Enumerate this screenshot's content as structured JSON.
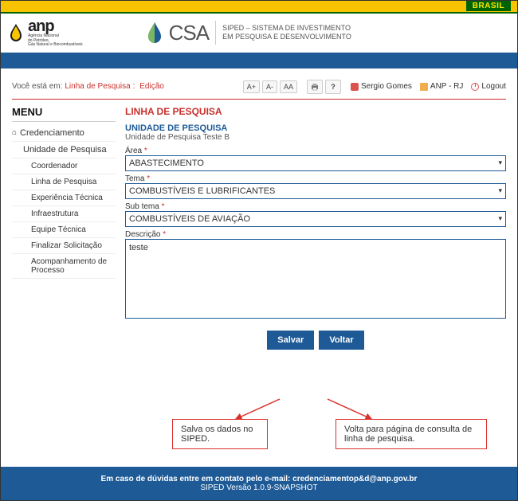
{
  "brasil_label": "BRASIL",
  "anp": {
    "name": "anp",
    "sub1": "Agência Nacional",
    "sub2": "do Petróleo,",
    "sub3": "Gás Natural e Biocombustíveis"
  },
  "csa": {
    "name": "CSA",
    "line1": "SIPED – SISTEMA DE INVESTIMENTO",
    "line2": "EM PESQUISA E DESENVOLVIMENTO"
  },
  "breadcrumb": {
    "label": "Você está em:",
    "link1": "Linha de Pesquisa",
    "link2": "Edição"
  },
  "toolbar": {
    "aplus": "A+",
    "aminus": "A-",
    "areset": "AA"
  },
  "user": {
    "name": "Sergio Gomes",
    "org": "ANP - RJ",
    "logout": "Logout"
  },
  "menu": {
    "title": "MENU",
    "cred": "Credenciamento",
    "unit": "Unidade de Pesquisa",
    "items": [
      "Coordenador",
      "Linha de Pesquisa",
      "Experiência Técnica",
      "Infraestrutura",
      "Equipe Técnica",
      "Finalizar Solicitação",
      "Acompanhamento de Processo"
    ]
  },
  "form": {
    "title": "LINHA DE PESQUISA",
    "section_title": "UNIDADE DE PESQUISA",
    "section_sub": "Unidade de Pesquisa Teste B",
    "area_label": "Área",
    "area_value": "ABASTECIMENTO",
    "tema_label": "Tema",
    "tema_value": "COMBUSTÍVEIS E LUBRIFICANTES",
    "subtema_label": "Sub tema",
    "subtema_value": "COMBUSTÍVEIS DE AVIAÇÃO",
    "desc_label": "Descrição",
    "desc_value": "teste",
    "save": "Salvar",
    "back": "Voltar"
  },
  "annot": {
    "save": "Salva os dados no SIPED.",
    "back": "Volta para página de consulta de linha de pesquisa."
  },
  "footer": {
    "line1a": "Em caso de dúvidas entre em contato pelo e-mail: ",
    "email": "credenciamentop&d@anp.gov.br",
    "line2": "SIPED Versão 1.0.9-SNAPSHOT"
  }
}
